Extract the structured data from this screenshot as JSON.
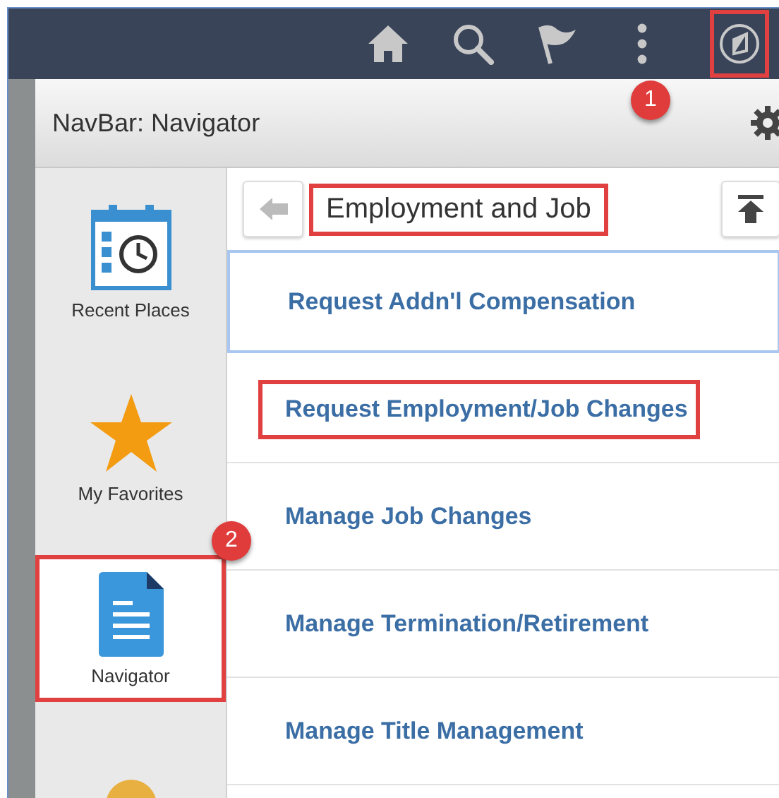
{
  "navbar": {
    "icons": [
      {
        "kind": "home",
        "highlighted": false
      },
      {
        "kind": "search",
        "highlighted": false
      },
      {
        "kind": "flag",
        "highlighted": false
      },
      {
        "kind": "more",
        "highlighted": false
      },
      {
        "kind": "navigator",
        "highlighted": true,
        "callout": "1"
      }
    ]
  },
  "panel": {
    "title": "NavBar: Navigator"
  },
  "sidebar": {
    "items": [
      {
        "kind": "recent",
        "label": "Recent Places",
        "selected": false,
        "highlighted": false
      },
      {
        "kind": "favorites",
        "label": "My Favorites",
        "selected": false,
        "highlighted": false
      },
      {
        "kind": "navigator",
        "label": "Navigator",
        "selected": true,
        "highlighted": true,
        "callout": "2"
      },
      {
        "kind": "partial"
      }
    ]
  },
  "folder": {
    "title": "Employment and Job",
    "highlighted": true
  },
  "menu": {
    "items": [
      {
        "label": "Request Addn'l Compensation",
        "focused": true,
        "highlighted": false
      },
      {
        "label": "Request Employment/Job Changes",
        "focused": false,
        "highlighted": true
      },
      {
        "label": "Manage Job Changes",
        "focused": false,
        "highlighted": false
      },
      {
        "label": "Manage Termination/Retirement",
        "focused": false,
        "highlighted": false
      },
      {
        "label": "Manage Title Management",
        "focused": false,
        "highlighted": false
      }
    ]
  }
}
